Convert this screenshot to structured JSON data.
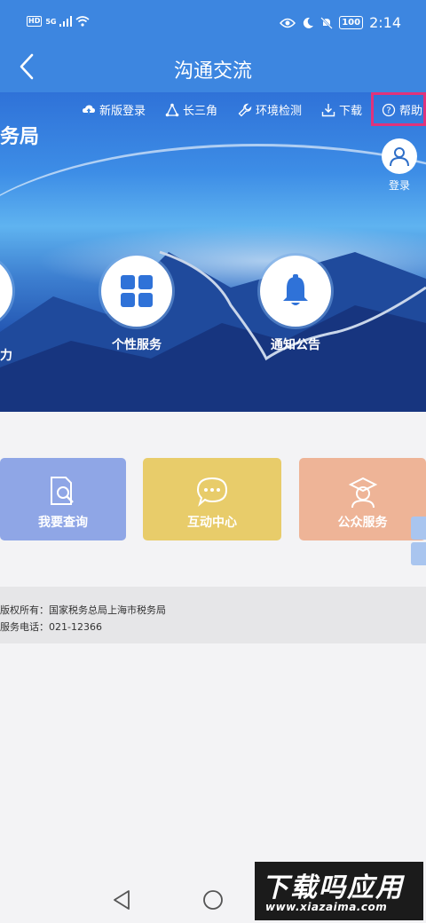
{
  "status_bar": {
    "hd": "HD",
    "network": "5G",
    "battery": "100",
    "time": "2:14"
  },
  "header": {
    "title": "沟通交流"
  },
  "top_links": [
    {
      "label": "新版登录",
      "icon": "cloud-up-icon"
    },
    {
      "label": "长三角",
      "icon": "triangle-nodes-icon"
    },
    {
      "label": "环境检测",
      "icon": "wrench-icon"
    },
    {
      "label": "下载",
      "icon": "download-icon"
    },
    {
      "label": "帮助",
      "icon": "question-circle-icon"
    }
  ],
  "banner": {
    "brand_text": "务局",
    "login_label": "登录"
  },
  "features": [
    {
      "label": "个性服务",
      "icon": "grid-icon"
    },
    {
      "label": "通知公告",
      "icon": "bell-icon"
    }
  ],
  "tiles": [
    {
      "label": "我要查询",
      "icon": "document-search-icon",
      "color": "#8fa6e6"
    },
    {
      "label": "互动中心",
      "icon": "chat-bubble-icon",
      "color": "#e8cc6a"
    },
    {
      "label": "公众服务",
      "icon": "service-person-icon",
      "color": "#eeb497"
    }
  ],
  "footer": {
    "copyright": "版权所有：国家税务总局上海市税务局",
    "phone": "服务电话：021-12366"
  },
  "watermark": {
    "title": "下载吗应用",
    "url": "www.xiazaima.com"
  },
  "colors": {
    "header": "#3d86e0",
    "highlight": "#e0337b"
  }
}
